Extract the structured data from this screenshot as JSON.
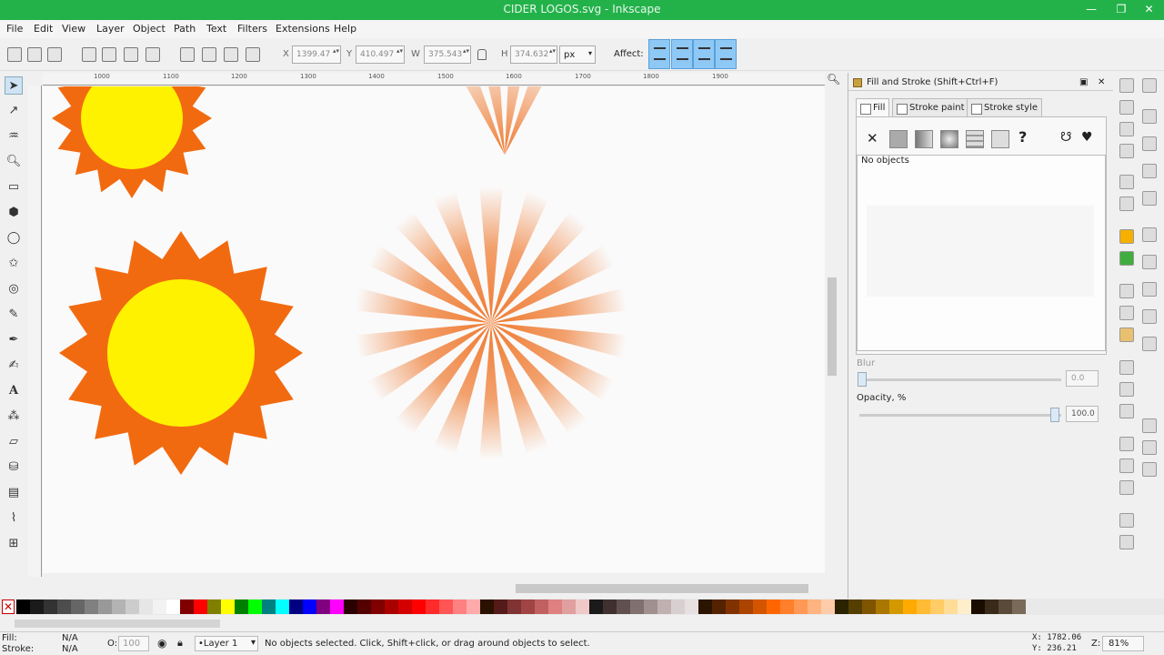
{
  "window": {
    "title": "CIDER LOGOS.svg - Inkscape"
  },
  "menu": [
    "File",
    "Edit",
    "View",
    "Layer",
    "Object",
    "Path",
    "Text",
    "Filters",
    "Extensions",
    "Help"
  ],
  "toolbar": {
    "x_label": "X",
    "x_value": "1399.47",
    "y_label": "Y",
    "y_value": "410.497",
    "w_label": "W",
    "w_value": "375.543",
    "h_label": "H",
    "h_value": "374.632",
    "unit": "px",
    "affect_label": "Affect:"
  },
  "ruler": {
    "top": [
      "1000",
      "1100",
      "1200",
      "1300",
      "1400",
      "1500",
      "1600",
      "1700",
      "1800",
      "1900"
    ]
  },
  "panel": {
    "title": "Fill and Stroke (Shift+Ctrl+F)",
    "tabs": [
      "Fill",
      "Stroke paint",
      "Stroke style"
    ],
    "no_objects": "No objects",
    "blur_label": "Blur",
    "blur_value": "0.0",
    "opacity_label": "Opacity, %",
    "opacity_value": "100.0"
  },
  "status": {
    "fill_label": "Fill:",
    "fill_value": "N/A",
    "stroke_label": "Stroke:",
    "stroke_value": "N/A",
    "opacity_label": "O:",
    "opacity_value": "100",
    "layer": "•Layer 1",
    "message": "No objects selected. Click, Shift+click, or drag around objects to select.",
    "x_coord": "X: 1782.06",
    "y_coord": "Y: 236.21",
    "zoom_label": "Z:",
    "zoom_value": "81%"
  },
  "colors": {
    "titlebar": "#23b24a",
    "sun_orange": "#f26a10",
    "sun_yellow": "#fff200",
    "ray_orange": "#ef7a30",
    "affect_active": "#8ec8f5"
  },
  "palette": [
    "#000000",
    "#1a1a1a",
    "#333333",
    "#4d4d4d",
    "#666666",
    "#808080",
    "#999999",
    "#b3b3b3",
    "#cccccc",
    "#e6e6e6",
    "#f2f2f2",
    "#ffffff",
    "#800000",
    "#ff0000",
    "#808000",
    "#ffff00",
    "#008000",
    "#00ff00",
    "#008080",
    "#00ffff",
    "#000080",
    "#0000ff",
    "#800080",
    "#ff00ff",
    "#2b0000",
    "#550000",
    "#800000",
    "#aa0000",
    "#d40000",
    "#ff0000",
    "#ff2a2a",
    "#ff5555",
    "#ff8080",
    "#ffaaaa",
    "#2b1100",
    "#551a1a",
    "#803333",
    "#a04444",
    "#c06060",
    "#e08080",
    "#e0a0a0",
    "#f0c8c8",
    "#1a1a1a",
    "#403030",
    "#605050",
    "#807070",
    "#a09090",
    "#c0b0b0",
    "#d8d0d0",
    "#e8e0e0",
    "#2b1400",
    "#552200",
    "#803300",
    "#aa4400",
    "#d45500",
    "#ff6600",
    "#ff7f2a",
    "#ff9955",
    "#ffb380",
    "#ffccaa",
    "#2b2200",
    "#553f00",
    "#805500",
    "#aa7700",
    "#d49900",
    "#ffaa00",
    "#ffbb33",
    "#ffcc66",
    "#ffdd99",
    "#ffeecc",
    "#1a0d00",
    "#3a2a1a",
    "#5a4a3a",
    "#7a6a5a"
  ]
}
